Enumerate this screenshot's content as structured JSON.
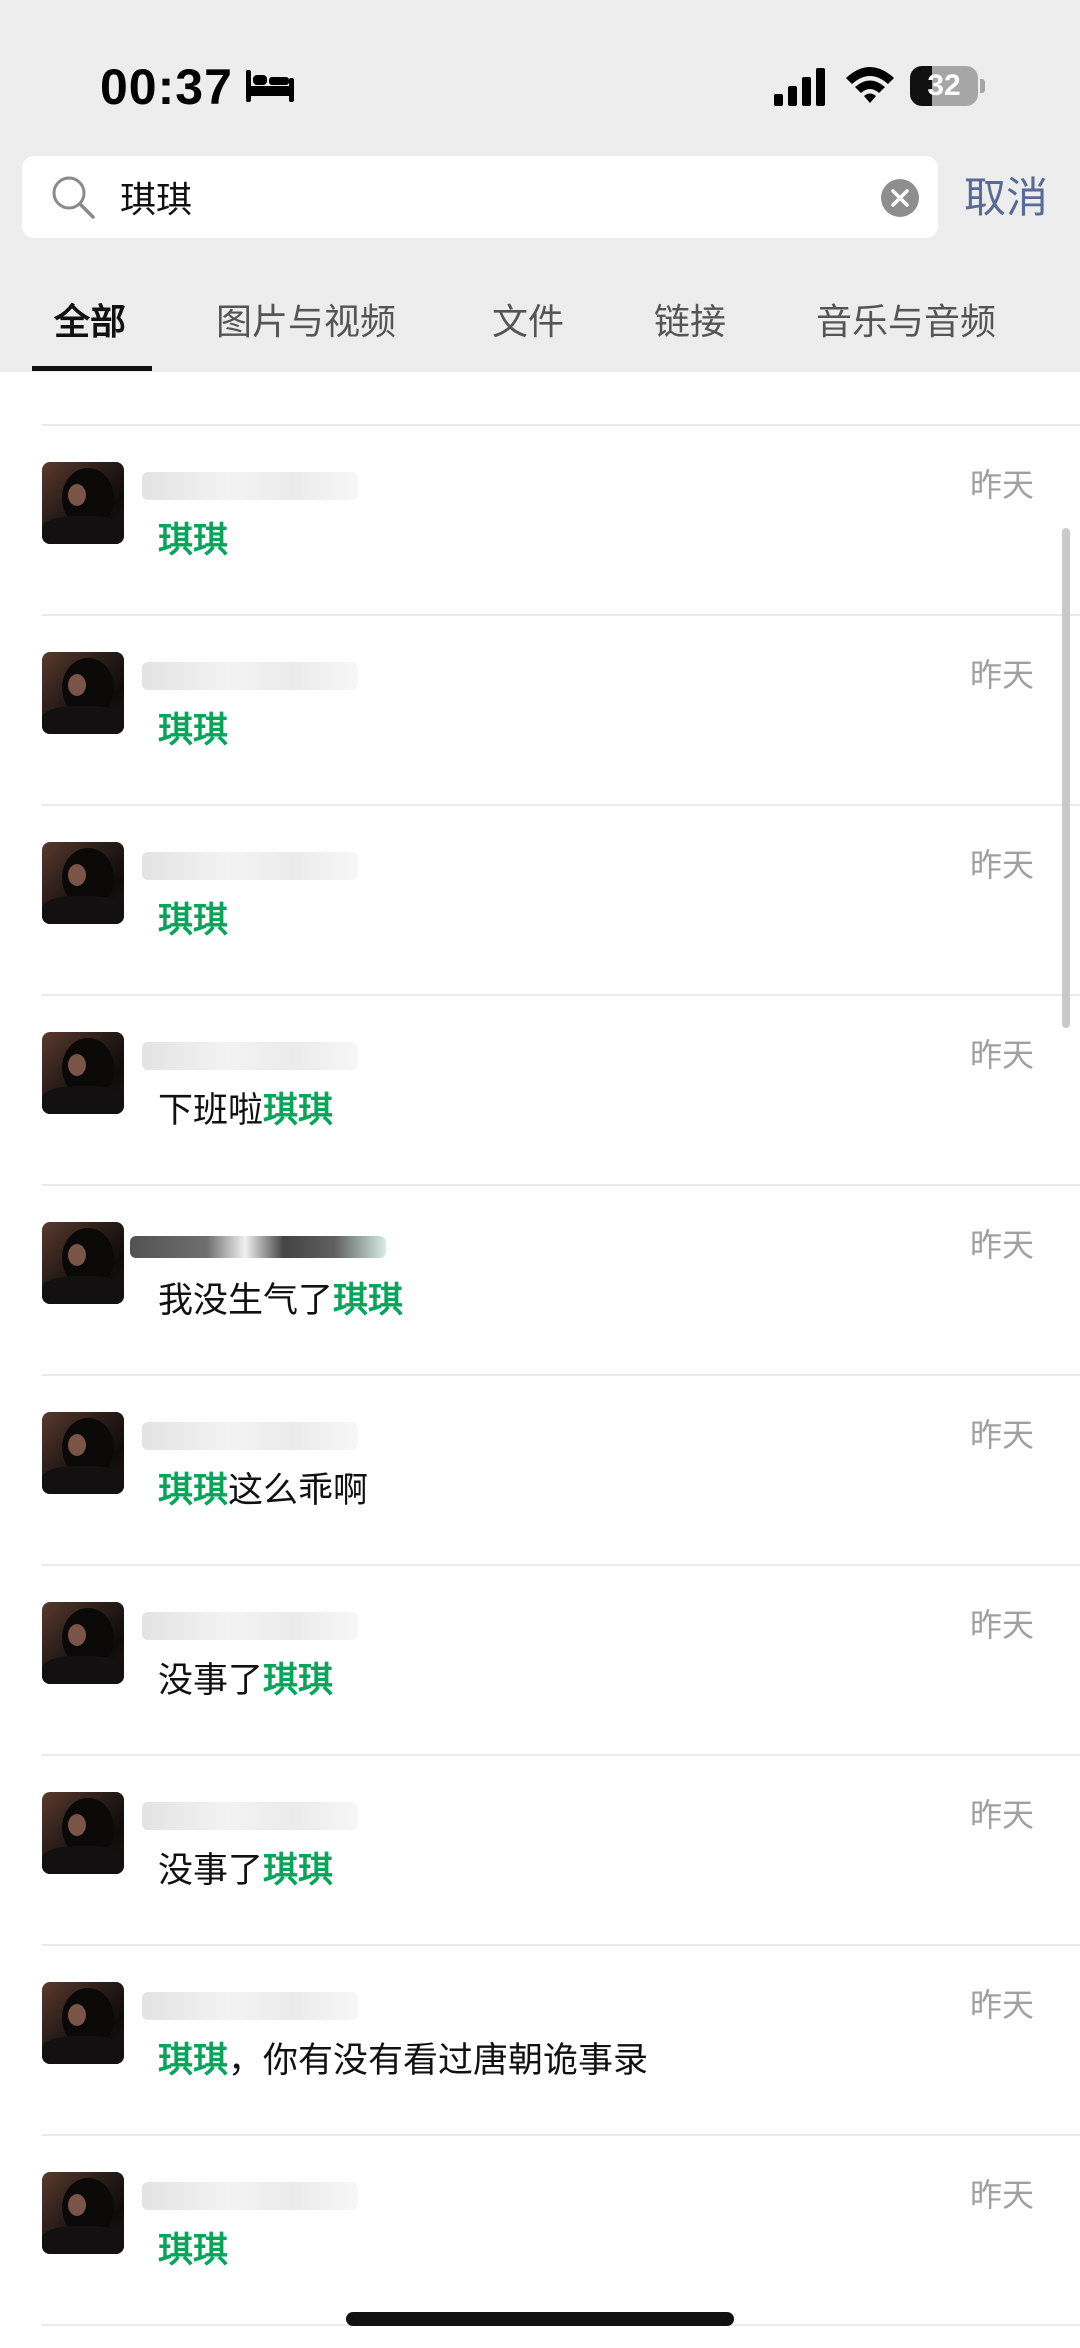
{
  "status_bar": {
    "time": "00:37",
    "battery_percent": "32",
    "battery_level": 0.32,
    "icons": [
      "bed-icon",
      "cellular-signal-icon",
      "wifi-icon",
      "battery-icon"
    ]
  },
  "search": {
    "query": "琪琪",
    "cancel_label": "取消",
    "icons": [
      "search-icon",
      "clear-icon"
    ]
  },
  "tabs": [
    {
      "label": "全部",
      "active": true
    },
    {
      "label": "图片与视频",
      "active": false
    },
    {
      "label": "文件",
      "active": false
    },
    {
      "label": "链接",
      "active": false
    },
    {
      "label": "音乐与音频",
      "active": false
    }
  ],
  "colors": {
    "highlight": "#07a55a",
    "link": "#576b95",
    "header_background": "#ededed"
  },
  "results": [
    {
      "before": "",
      "highlight": "琪琪",
      "after": "",
      "date": "昨天"
    },
    {
      "before": "",
      "highlight": "琪琪",
      "after": "",
      "date": "昨天"
    },
    {
      "before": "",
      "highlight": "琪琪",
      "after": "",
      "date": "昨天"
    },
    {
      "before": "下班啦",
      "highlight": "琪琪",
      "after": "",
      "date": "昨天"
    },
    {
      "before": "我没生气了",
      "highlight": "琪琪",
      "after": "",
      "date": "昨天"
    },
    {
      "before": "",
      "highlight": "琪琪",
      "after": "这么乖啊",
      "date": "昨天"
    },
    {
      "before": "没事了",
      "highlight": "琪琪",
      "after": "",
      "date": "昨天"
    },
    {
      "before": "没事了",
      "highlight": "琪琪",
      "after": "",
      "date": "昨天"
    },
    {
      "before": "",
      "highlight": "琪琪",
      "after": "，你有没有看过唐朝诡事录",
      "date": "昨天"
    },
    {
      "before": "",
      "highlight": "琪琪",
      "after": "",
      "date": "昨天"
    }
  ]
}
